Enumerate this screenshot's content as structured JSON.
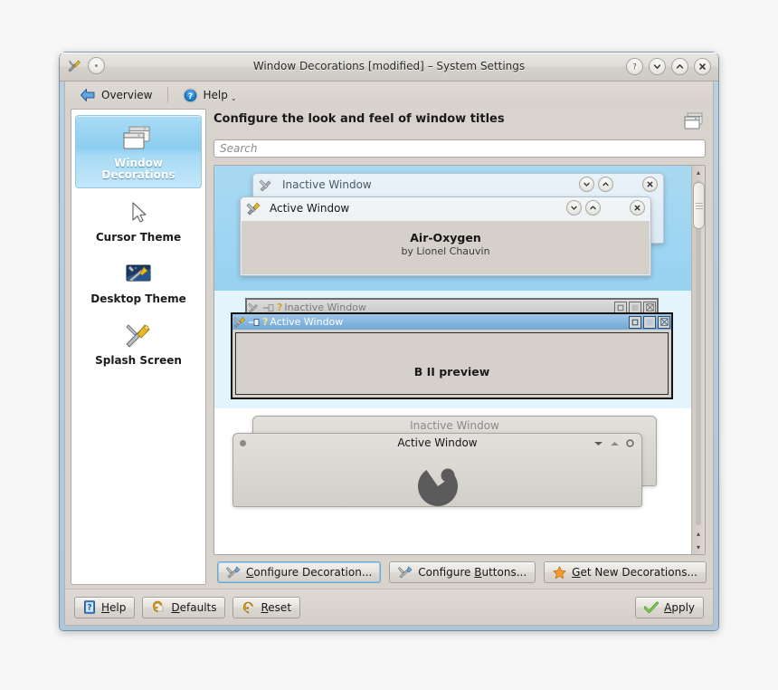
{
  "window": {
    "title": "Window Decorations [modified] – System Settings",
    "titlebar_buttons": [
      {
        "name": "help-button",
        "glyph": "?"
      },
      {
        "name": "shade-button",
        "glyph": "⌄"
      },
      {
        "name": "maximize-button",
        "glyph": "⌃"
      },
      {
        "name": "close-button",
        "glyph": "✕"
      }
    ],
    "app_icon": "tools-icon",
    "sticky_icon": "on-all-desktops-icon"
  },
  "toolbar": {
    "overview_label": "Overview",
    "overview_icon": "back-arrow-icon",
    "help_label": "Help",
    "help_icon": "help-circle-icon",
    "help_menu_chevron": "⌄"
  },
  "sidebar": {
    "items": [
      {
        "label_line1": "Window",
        "label_line2": "Decorations",
        "icon": "windows-stack-icon",
        "selected": true
      },
      {
        "label_line1": "Cursor Theme",
        "label_line2": "",
        "icon": "cursor-arrow-icon",
        "selected": false
      },
      {
        "label_line1": "Desktop Theme",
        "label_line2": "",
        "icon": "desktop-tools-icon",
        "selected": false
      },
      {
        "label_line1": "Splash Screen",
        "label_line2": "",
        "icon": "tools-icon",
        "selected": false
      }
    ]
  },
  "pane": {
    "title": "Configure the look and feel of window titles",
    "corner_icon": "windows-stack-icon"
  },
  "search": {
    "placeholder": "Search",
    "value": ""
  },
  "theme_list": {
    "inactive_window_label": "Inactive Window",
    "active_window_label": "Active Window",
    "items": [
      {
        "style": "air-oxygen",
        "name": "Air-Oxygen",
        "author": "by Lionel Chauvin",
        "state": "selected",
        "buttons": [
          "shade-button",
          "maximize-button",
          "close-button"
        ]
      },
      {
        "style": "b2",
        "name": "B II preview",
        "author": "",
        "state": "hover",
        "help_glyph": "?",
        "buttons": [
          "sticky-button",
          "help-button",
          "minimize-button",
          "maximize-button",
          "close-button"
        ]
      },
      {
        "style": "oxygen",
        "name": "",
        "author": "",
        "state": "normal",
        "logo": "kde-oxygen-logo",
        "buttons": [
          "shade-button",
          "maximize-button",
          "close-button"
        ]
      }
    ]
  },
  "scrollbar": {
    "up_arrow": "▴",
    "down_arrow": "▾",
    "thumb_position_pct": 6
  },
  "actions": [
    {
      "label_pre": "",
      "accel": "C",
      "label_post": "onfigure Decoration...",
      "icon": "wrench-icon",
      "focused": true,
      "name": "configure-decoration-button"
    },
    {
      "label_pre": "Configure ",
      "accel": "B",
      "label_post": "uttons...",
      "icon": "wrench-icon",
      "focused": false,
      "name": "configure-buttons-button"
    },
    {
      "label_pre": "",
      "accel": "G",
      "label_post": "et New Decorations...",
      "icon": "star-icon",
      "focused": false,
      "name": "get-new-decorations-button"
    }
  ],
  "bottom_bar": {
    "buttons": [
      {
        "label_pre": "",
        "accel": "H",
        "label_post": "elp",
        "icon": "help-book-icon",
        "name": "help-button"
      },
      {
        "label_pre": "",
        "accel": "D",
        "label_post": "efaults",
        "icon": "undo-icon",
        "name": "defaults-button"
      },
      {
        "label_pre": "",
        "accel": "R",
        "label_post": "eset",
        "icon": "reset-icon",
        "name": "reset-button"
      }
    ],
    "apply": {
      "label_pre": "",
      "accel": "A",
      "label_post": "pply",
      "icon": "check-icon",
      "name": "apply-button"
    }
  },
  "colors": {
    "window_frame": "#b9cfe2",
    "selection_blue": "#97d2f1",
    "hover_blue": "#e3f4fd",
    "panel_gray": "#d8d4cd",
    "apply_check_green": "#4fa32a"
  }
}
